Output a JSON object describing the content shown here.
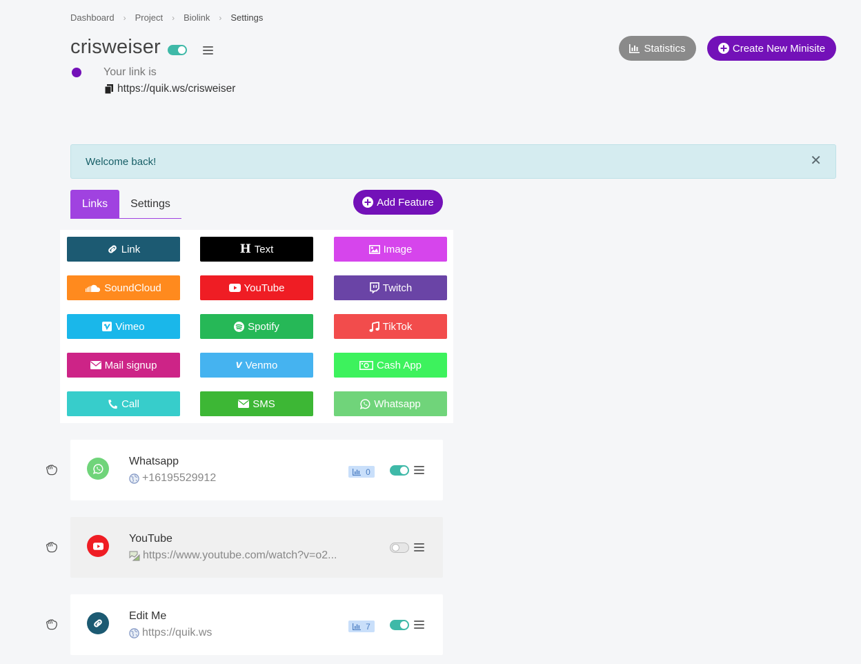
{
  "breadcrumb": [
    "Dashboard",
    "Project",
    "Biolink",
    "Settings"
  ],
  "header": {
    "title": "crisweiser",
    "link_label": "Your link is",
    "link_url": "https://quik.ws/crisweiser",
    "statistics_label": "Statistics",
    "create_label": "Create New Minisite"
  },
  "alert": {
    "message": "Welcome back!"
  },
  "tabs": {
    "links": "Links",
    "settings": "Settings"
  },
  "add_feature_label": "Add Feature",
  "features": [
    {
      "label": "Link",
      "color": "#1c5a72",
      "icon": "link-icon"
    },
    {
      "label": "Text",
      "color": "#000000",
      "icon": "heading-icon"
    },
    {
      "label": "Image",
      "color": "#d645ec",
      "icon": "image-icon"
    },
    {
      "label": "SoundCloud",
      "color": "#ff8a1e",
      "icon": "soundcloud-icon"
    },
    {
      "label": "YouTube",
      "color": "#ef1d24",
      "icon": "youtube-icon"
    },
    {
      "label": "Twitch",
      "color": "#6a44a6",
      "icon": "twitch-icon"
    },
    {
      "label": "Vimeo",
      "color": "#1ab7ea",
      "icon": "vimeo-icon"
    },
    {
      "label": "Spotify",
      "color": "#26b857",
      "icon": "spotify-icon"
    },
    {
      "label": "TikTok",
      "color": "#f24c4c",
      "icon": "music-note-icon"
    },
    {
      "label": "Mail signup",
      "color": "#cd2487",
      "icon": "envelope-icon"
    },
    {
      "label": "Venmo",
      "color": "#45b3f0",
      "icon": "venmo-icon"
    },
    {
      "label": "Cash App",
      "color": "#3df25d",
      "icon": "money-bill-icon"
    },
    {
      "label": "Call",
      "color": "#37cdcb",
      "icon": "phone-icon"
    },
    {
      "label": "SMS",
      "color": "#3db735",
      "icon": "envelope-icon"
    },
    {
      "label": "Whatsapp",
      "color": "#70d47a",
      "icon": "whatsapp-icon"
    }
  ],
  "items": [
    {
      "name": "Whatsapp",
      "sub": "+16195529912",
      "clicks": "0",
      "enabled": true,
      "icon": "whatsapp-icon",
      "icon_color": "#70d47a"
    },
    {
      "name": "YouTube",
      "sub": "https://www.youtube.com/watch?v=o2...",
      "clicks": "",
      "enabled": false,
      "icon": "youtube-icon",
      "icon_color": "#ef1d24"
    },
    {
      "name": "Edit Me",
      "sub": "https://quik.ws",
      "clicks": "7",
      "enabled": true,
      "icon": "link-icon",
      "icon_color": "#1c5a72"
    }
  ],
  "colors": {
    "primary": "#7311b8",
    "tab_active": "#a042e0",
    "toggle_on": "#3fb9a8",
    "alert_bg": "#d5ecf0"
  }
}
